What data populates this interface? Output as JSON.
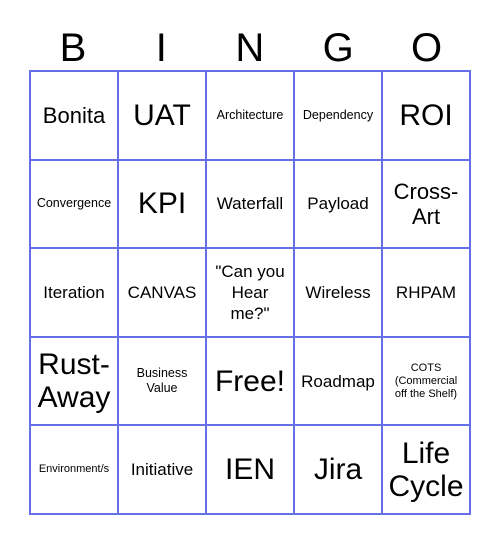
{
  "card": {
    "title": "BINGO",
    "header_letters": [
      "B",
      "I",
      "N",
      "G",
      "O"
    ],
    "grid_size": "5x5",
    "border_color": "#6570e8",
    "text_color": "#000000",
    "background_color": "#ffffff",
    "free_space": "Free!",
    "rows": [
      [
        {
          "text": "Bonita",
          "size": "lg"
        },
        {
          "text": "UAT",
          "size": "xl"
        },
        {
          "text": "Architecture",
          "size": "sm"
        },
        {
          "text": "Dependency",
          "size": "sm"
        },
        {
          "text": "ROI",
          "size": "xl"
        }
      ],
      [
        {
          "text": "Convergence",
          "size": "sm"
        },
        {
          "text": "KPI",
          "size": "xl"
        },
        {
          "text": "Waterfall",
          "size": "md"
        },
        {
          "text": "Payload",
          "size": "md"
        },
        {
          "text": "Cross-\nArt",
          "size": "lg"
        }
      ],
      [
        {
          "text": "Iteration",
          "size": "md"
        },
        {
          "text": "CANVAS",
          "size": "md"
        },
        {
          "text": "\"Can you\nHear\nme?\"",
          "size": "md"
        },
        {
          "text": "Wireless",
          "size": "md"
        },
        {
          "text": "RHPAM",
          "size": "md"
        }
      ],
      [
        {
          "text": "Rust-\nAway",
          "size": "xl"
        },
        {
          "text": "Business\nValue",
          "size": "sm"
        },
        {
          "text": "Free!",
          "size": "xl"
        },
        {
          "text": "Roadmap",
          "size": "md"
        },
        {
          "text": "COTS\n(Commercial\noff the Shelf)",
          "size": "xs"
        }
      ],
      [
        {
          "text": "Environment/s",
          "size": "xs"
        },
        {
          "text": "Initiative",
          "size": "md"
        },
        {
          "text": "IEN",
          "size": "xl"
        },
        {
          "text": "Jira",
          "size": "xl"
        },
        {
          "text": "Life\nCycle",
          "size": "xl"
        }
      ]
    ]
  }
}
